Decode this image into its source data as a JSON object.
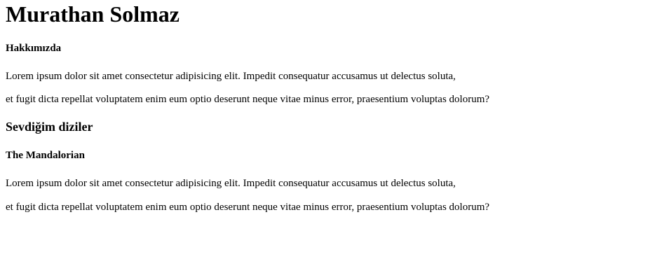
{
  "header": {
    "title": "Murathan Solmaz"
  },
  "about": {
    "heading": "Hakkımızda",
    "lines": [
      "Lorem ipsum dolor sit amet consectetur adipisicing elit. Impedit consequatur accusamus ut delectus soluta,",
      "et fugit dicta repellat voluptatem enim eum optio deserunt neque vitae minus error, praesentium voluptas dolorum?"
    ]
  },
  "series": {
    "heading": "Sevdiğim diziler",
    "show": {
      "title": "The Mandalorian",
      "lines": [
        "Lorem ipsum dolor sit amet consectetur adipisicing elit. Impedit consequatur accusamus ut delectus soluta,",
        "et fugit dicta repellat voluptatem enim eum optio deserunt neque vitae minus error, praesentium voluptas dolorum?"
      ]
    }
  }
}
